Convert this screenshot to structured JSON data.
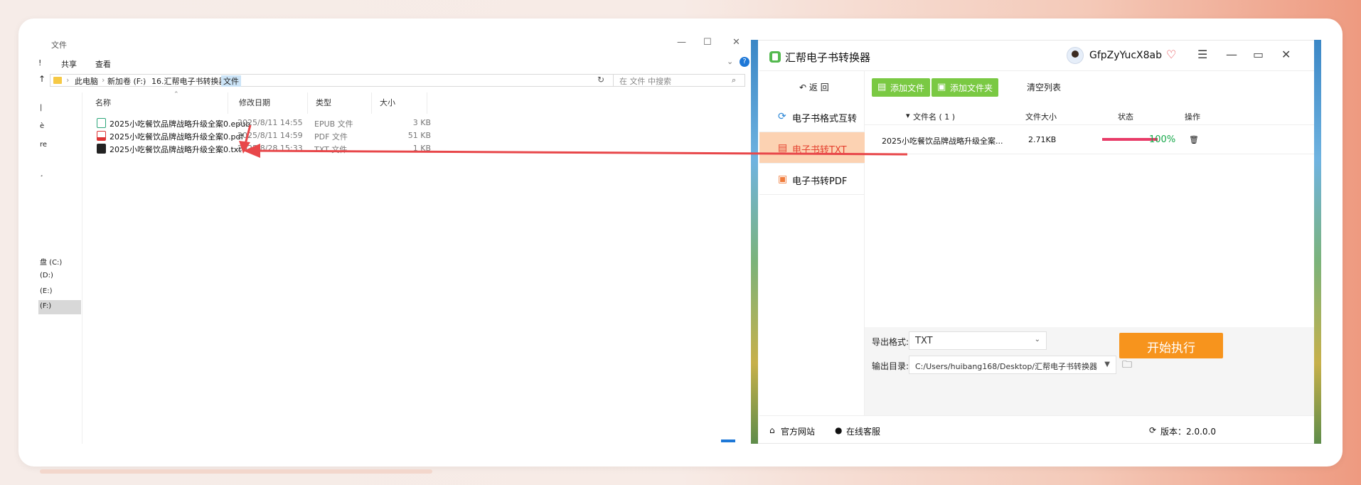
{
  "explorer": {
    "title": "文件",
    "ribbon_tabs": [
      "共享",
      "查看"
    ],
    "ribbon_marker": "!",
    "breadcrumb": [
      "此电脑",
      "新加卷 (F:)",
      "16.汇帮电子书转换器",
      "文件"
    ],
    "search_placeholder": "在 文件 中搜索",
    "columns": {
      "name": "名称",
      "date": "修改日期",
      "type": "类型",
      "size": "大小"
    },
    "files": [
      {
        "name": "2025小吃餐饮品牌战略升级全案0.epub",
        "date": "2025/8/11 14:55",
        "type": "EPUB 文件",
        "size": "3 KB",
        "icon": "epub-icon"
      },
      {
        "name": "2025小吃餐饮品牌战略升级全案0.pdf",
        "date": "2025/8/11 14:59",
        "type": "PDF 文件",
        "size": "51 KB",
        "icon": "pdf-icon"
      },
      {
        "name": "2025小吃餐饮品牌战略升级全案0.txt",
        "date": "2025/8/28 15:33",
        "type": "TXT 文件",
        "size": "1 KB",
        "icon": "txt-icon"
      }
    ],
    "nav": [
      "|",
      "è",
      "re",
      "¸",
      "盘 (C:)",
      "(D:)",
      "(E:)",
      "(F:)"
    ]
  },
  "app": {
    "title": "汇帮电子书转换器",
    "username": "GfpZyYucX8ab",
    "back_label": "返 回",
    "sidebar": [
      {
        "label": "电子书格式互转",
        "icon": "refresh-icon",
        "active": false
      },
      {
        "label": "电子书转TXT",
        "icon": "document-icon",
        "active": true
      },
      {
        "label": "电子书转PDF",
        "icon": "pdf-icon",
        "active": false
      }
    ],
    "toolbar": {
      "add_file": "添加文件",
      "add_folder": "添加文件夹",
      "clear_list": "清空列表"
    },
    "table": {
      "col_name": "文件名 ( 1 )",
      "col_size": "文件大小",
      "col_status": "状态",
      "col_action": "操作",
      "rows": [
        {
          "name": "2025小吃餐饮品牌战略升级全案...",
          "size": "2.71KB",
          "progress": 100,
          "progress_label": "100%"
        }
      ]
    },
    "export_format_label": "导出格式:",
    "export_format_value": "TXT",
    "output_dir_label": "输出目录:",
    "output_dir_value": "C:/Users/huibang168/Desktop/汇帮电子书转换器",
    "start_button": "开始执行",
    "footer": {
      "website": "官方网站",
      "support": "在线客服",
      "version": "版本：2.0.0.0"
    },
    "colors": {
      "accent_green": "#7ac943",
      "start_orange": "#f7941d",
      "active_bg": "#fcd2b2",
      "active_text": "#e5412f",
      "progress_pink": "#e83b68",
      "pct_green": "#17a84a",
      "arrow_red": "#e8474a"
    }
  }
}
